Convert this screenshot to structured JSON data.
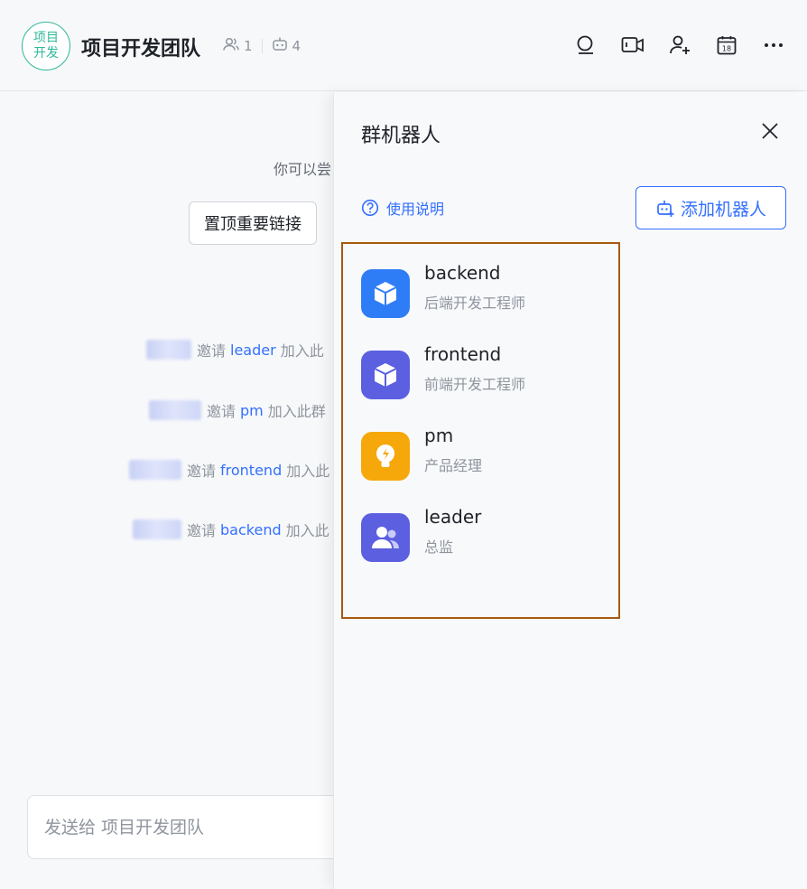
{
  "header": {
    "avatar_line1": "项目",
    "avatar_line2": "开发",
    "title": "项目开发团队",
    "member_count": "1",
    "bot_count": "4"
  },
  "chat": {
    "hint": "你可以尝",
    "pin_button": "置顶重要链接",
    "system_messages": [
      {
        "verb": "邀请",
        "name": "leader",
        "tail": "加入此"
      },
      {
        "verb": "邀请",
        "name": "pm",
        "tail": "加入此群"
      },
      {
        "verb": "邀请",
        "name": "frontend",
        "tail": "加入此"
      },
      {
        "verb": "邀请",
        "name": "backend",
        "tail": "加入此"
      }
    ],
    "input_placeholder": "发送给 项目开发团队"
  },
  "panel": {
    "title": "群机器人",
    "help_label": "使用说明",
    "add_button": "添加机器人",
    "bots": [
      {
        "name": "backend",
        "role": "后端开发工程师",
        "icon": "cube-icon",
        "color": "#2f7df6"
      },
      {
        "name": "frontend",
        "role": "前端开发工程师",
        "icon": "cube-icon",
        "color": "#5b5fe0"
      },
      {
        "name": "pm",
        "role": "产品经理",
        "icon": "lightbulb-icon",
        "color": "#f6a70a"
      },
      {
        "name": "leader",
        "role": "总监",
        "icon": "users-icon",
        "color": "#5b5fe0"
      }
    ]
  },
  "colors": {
    "accent": "#3370ff",
    "highlight_border": "#a65a0f",
    "group_avatar": "#2fb89a"
  }
}
